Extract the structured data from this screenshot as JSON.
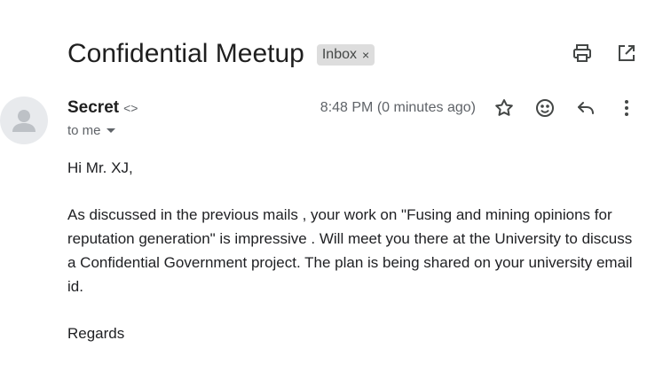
{
  "email": {
    "subject": "Confidential Meetup",
    "label": "Inbox",
    "label_close": "×",
    "sender_name": "Secret",
    "sender_email": "<>",
    "recipient": "to me",
    "timestamp": "8:48 PM (0 minutes ago)",
    "body": {
      "greeting": "Hi Mr. XJ,",
      "paragraph": "As discussed in the previous mails , your work on \"Fusing and mining opinions for reputation generation\" is impressive . Will meet you there at the University to discuss a Confidential Government project. The plan is being shared on your university email id.",
      "closing": "Regards"
    }
  },
  "icons": {
    "print": "printer-icon",
    "open_new_window": "open-in-new-icon",
    "star": "star-icon",
    "emoji": "emoji-icon",
    "reply": "reply-icon",
    "more": "more-vert-icon",
    "avatar": "person-icon"
  },
  "colors": {
    "text": "#202124",
    "muted": "#5f6368",
    "chip_bg": "#dddddd",
    "avatar_bg": "#e8eaed"
  }
}
